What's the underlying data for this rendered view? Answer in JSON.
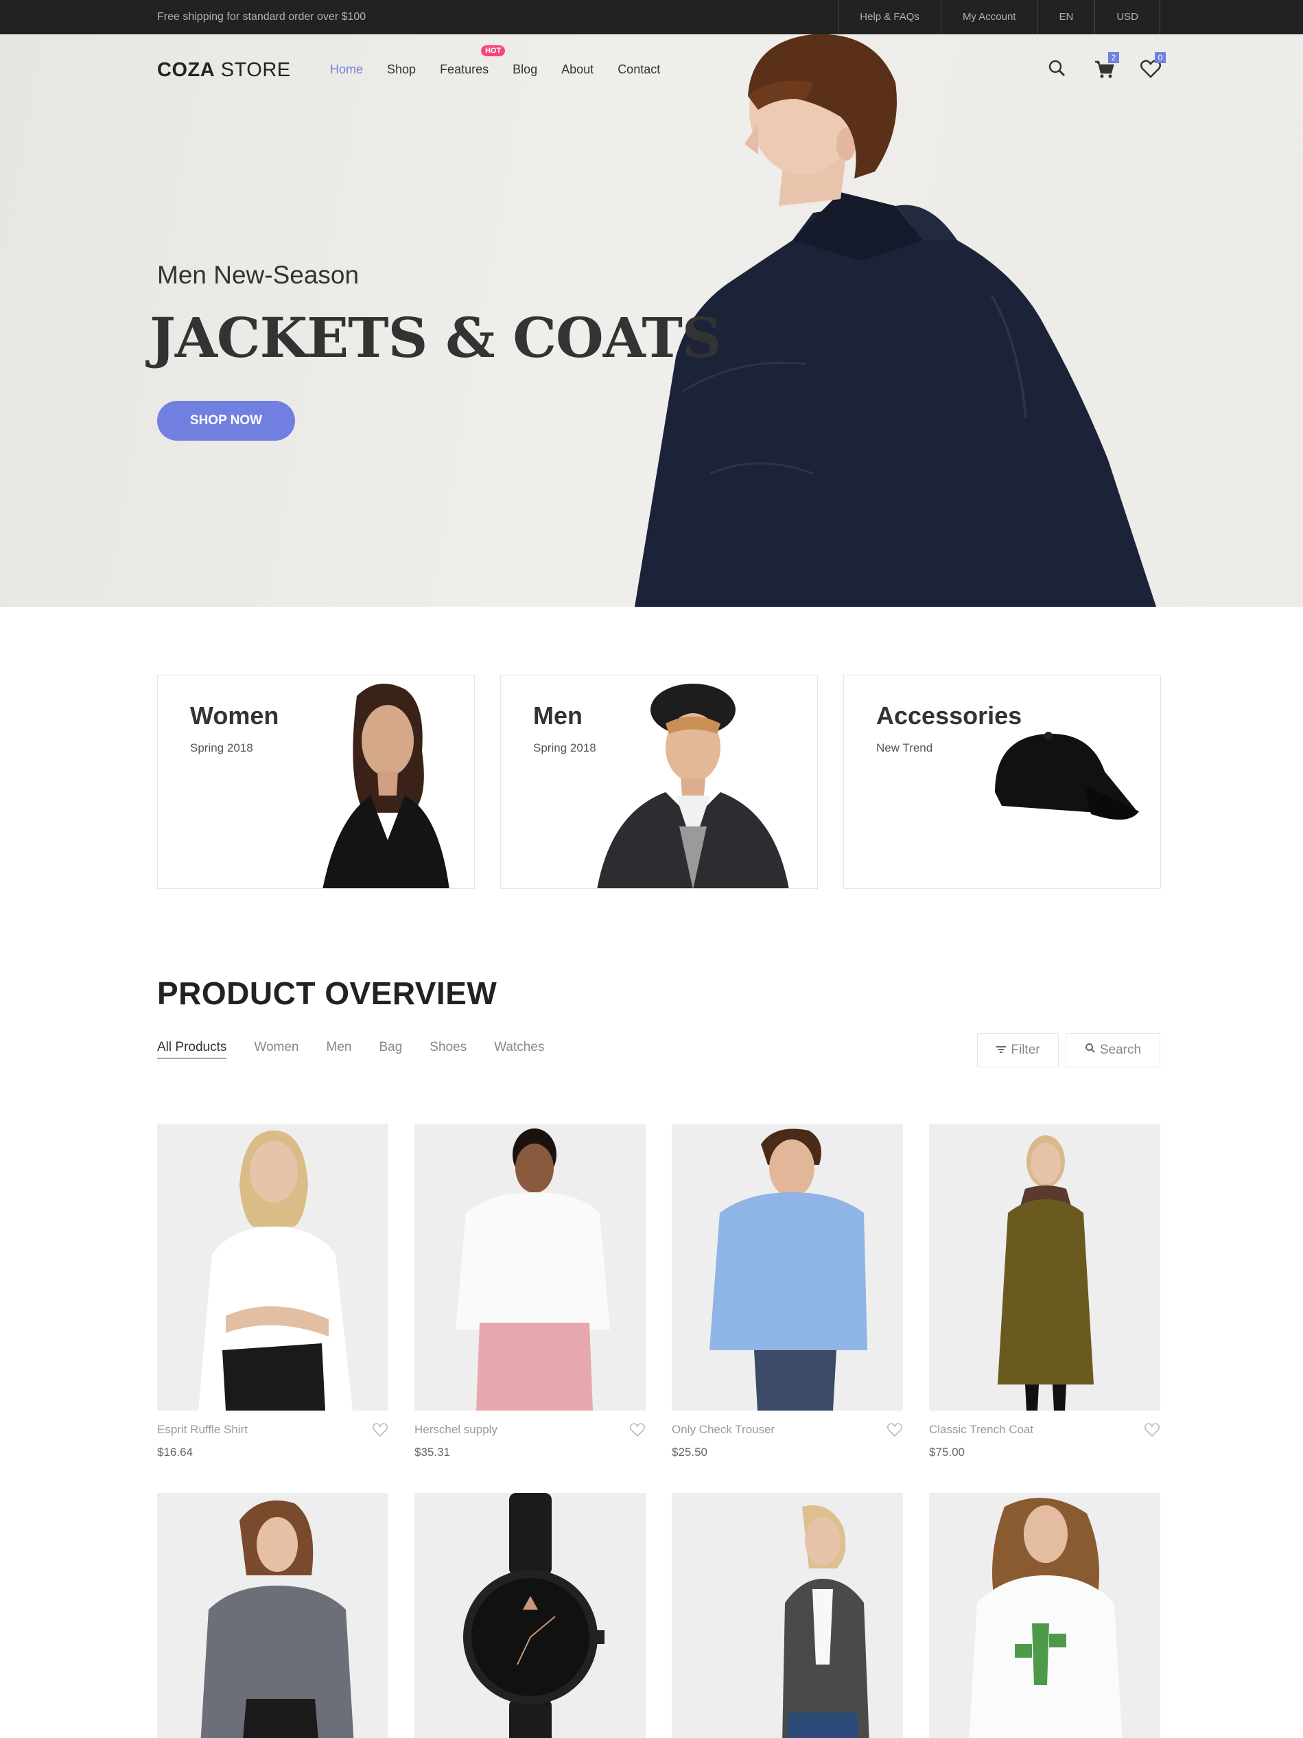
{
  "topbar": {
    "shipping": "Free shipping for standard order over $100",
    "links": [
      "Help & FAQs",
      "My Account",
      "EN",
      "USD"
    ]
  },
  "header": {
    "logo_bold": "COZA",
    "logo_rest": " STORE",
    "nav": [
      "Home",
      "Shop",
      "Features",
      "Blog",
      "About",
      "Contact"
    ],
    "hot_label": "HOT",
    "cart_count": "2",
    "wishlist_count": "0",
    "icons": [
      "search-icon",
      "cart-icon",
      "heart-icon"
    ]
  },
  "hero": {
    "subtitle": "Men New-Season",
    "title": "JACKETS & COATS",
    "cta": "SHOP NOW"
  },
  "banners": [
    {
      "title": "Women",
      "subtitle": "Spring 2018"
    },
    {
      "title": "Men",
      "subtitle": "Spring 2018"
    },
    {
      "title": "Accessories",
      "subtitle": "New Trend"
    }
  ],
  "overview": {
    "title": "PRODUCT OVERVIEW",
    "filters": [
      "All Products",
      "Women",
      "Men",
      "Bag",
      "Shoes",
      "Watches"
    ],
    "filter_button": "Filter",
    "search_button": "Search"
  },
  "products": [
    {
      "name": "Esprit Ruffle Shirt",
      "price": "$16.64"
    },
    {
      "name": "Herschel supply",
      "price": "$35.31"
    },
    {
      "name": "Only Check Trouser",
      "price": "$25.50"
    },
    {
      "name": "Classic Trench Coat",
      "price": "$75.00"
    },
    {
      "name": "",
      "price": ""
    },
    {
      "name": "",
      "price": ""
    },
    {
      "name": "",
      "price": ""
    },
    {
      "name": "",
      "price": ""
    }
  ],
  "colors": {
    "accent": "#717fe0",
    "hot": "#f74877",
    "topbar": "#222222"
  }
}
